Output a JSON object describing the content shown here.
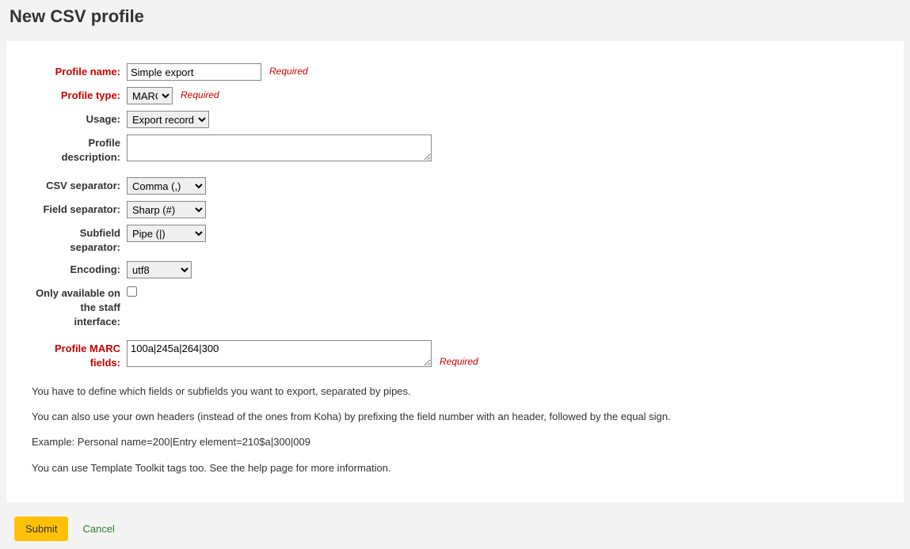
{
  "title": "New CSV profile",
  "labels": {
    "profile_name": "Profile name:",
    "profile_type": "Profile type:",
    "usage": "Usage:",
    "profile_description": "Profile description:",
    "csv_separator": "CSV separator:",
    "field_separator": "Field separator:",
    "subfield_separator": "Subfield separator:",
    "encoding": "Encoding:",
    "staff_only": "Only available on the staff interface:",
    "marc_fields": "Profile MARC fields:"
  },
  "values": {
    "profile_name": "Simple export",
    "profile_type": "MARC",
    "usage": "Export records",
    "profile_description": "",
    "csv_separator": "Comma (,)",
    "field_separator": "Sharp (#)",
    "subfield_separator": "Pipe (|)",
    "encoding": "utf8",
    "staff_only": false,
    "marc_fields": "100a|245a|264|300"
  },
  "required_text": "Required",
  "help": {
    "p1": "You have to define which fields or subfields you want to export, separated by pipes.",
    "p2": "You can also use your own headers (instead of the ones from Koha) by prefixing the field number with an header, followed by the equal sign.",
    "p3": "Example: Personal name=200|Entry element=210$a|300|009",
    "p4": "You can use Template Toolkit tags too. See the help page for more information."
  },
  "buttons": {
    "submit": "Submit",
    "cancel": "Cancel"
  }
}
